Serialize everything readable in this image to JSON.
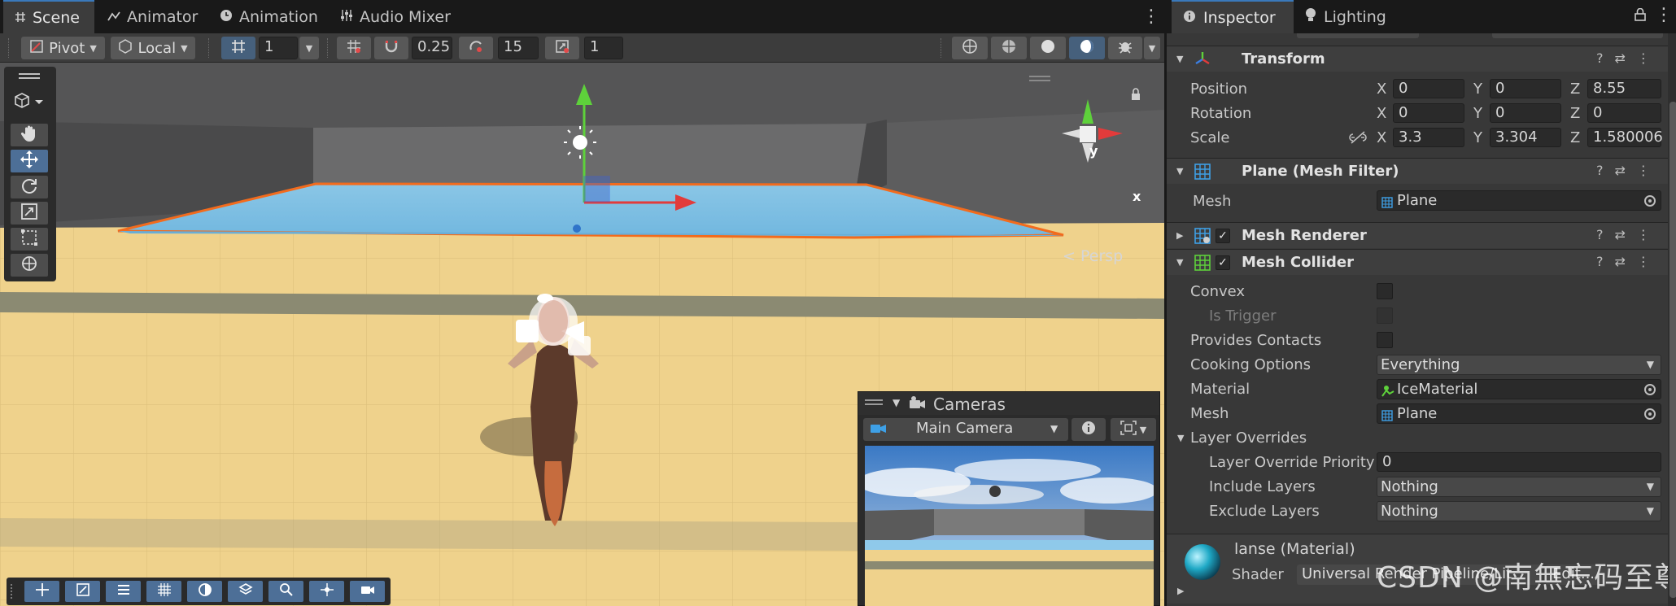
{
  "scene_tabs": [
    {
      "label": "Scene",
      "icon": "hash-icon"
    },
    {
      "label": "Animator",
      "icon": "animator-icon"
    },
    {
      "label": "Animation",
      "icon": "clock-icon"
    },
    {
      "label": "Audio Mixer",
      "icon": "mixer-icon"
    }
  ],
  "toolbar": {
    "pivot": "Pivot",
    "space": "Local",
    "grid_size": "1",
    "snap_move": "0.25",
    "snap_rotate": "15",
    "snap_scale": "1"
  },
  "viewport": {
    "projection": "Persp",
    "gizmo_y": "y",
    "gizmo_x": "x"
  },
  "cameras": {
    "title": "Cameras",
    "selected": "Main Camera"
  },
  "inspector_tabs": [
    {
      "label": "Inspector",
      "icon": "info-icon"
    },
    {
      "label": "Lighting",
      "icon": "bulb-icon"
    }
  ],
  "transform": {
    "title": "Transform",
    "position": {
      "label": "Position",
      "x": "0",
      "y": "0",
      "z": "8.55"
    },
    "rotation": {
      "label": "Rotation",
      "x": "0",
      "y": "0",
      "z": "0"
    },
    "scale": {
      "label": "Scale",
      "x": "3.3",
      "y": "3.304",
      "z": "1.580006"
    },
    "axis_x": "X",
    "axis_y": "Y",
    "axis_z": "Z"
  },
  "mesh_filter": {
    "title": "Plane (Mesh Filter)",
    "mesh_label": "Mesh",
    "mesh_value": "Plane"
  },
  "mesh_renderer": {
    "title": "Mesh Renderer"
  },
  "mesh_collider": {
    "title": "Mesh Collider",
    "convex": "Convex",
    "is_trigger": "Is Trigger",
    "provides_contacts": "Provides Contacts",
    "cooking_options_label": "Cooking Options",
    "cooking_options_value": "Everything",
    "material_label": "Material",
    "material_value": "IceMaterial",
    "mesh_label": "Mesh",
    "mesh_value": "Plane",
    "layer_overrides": "Layer Overrides",
    "layer_override_priority_label": "Layer Override Priority",
    "layer_override_priority_value": "0",
    "include_layers_label": "Include Layers",
    "include_layers_value": "Nothing",
    "exclude_layers_label": "Exclude Layers",
    "exclude_layers_value": "Nothing"
  },
  "material": {
    "name": "lanse (Material)",
    "shader_label": "Shader",
    "shader_value": "Universal Render Pipeline/Lit",
    "edit_label": "Edit..."
  },
  "watermark": "CSDN @南無忘码至尊",
  "colors": {
    "accent": "#3a79bb",
    "plane_blue": "#7fc0e4",
    "selection_orange": "#f26b1d",
    "floor_sand": "#f1d48f",
    "gizmo_green": "#5ed13b",
    "gizmo_red": "#e23b3b"
  }
}
